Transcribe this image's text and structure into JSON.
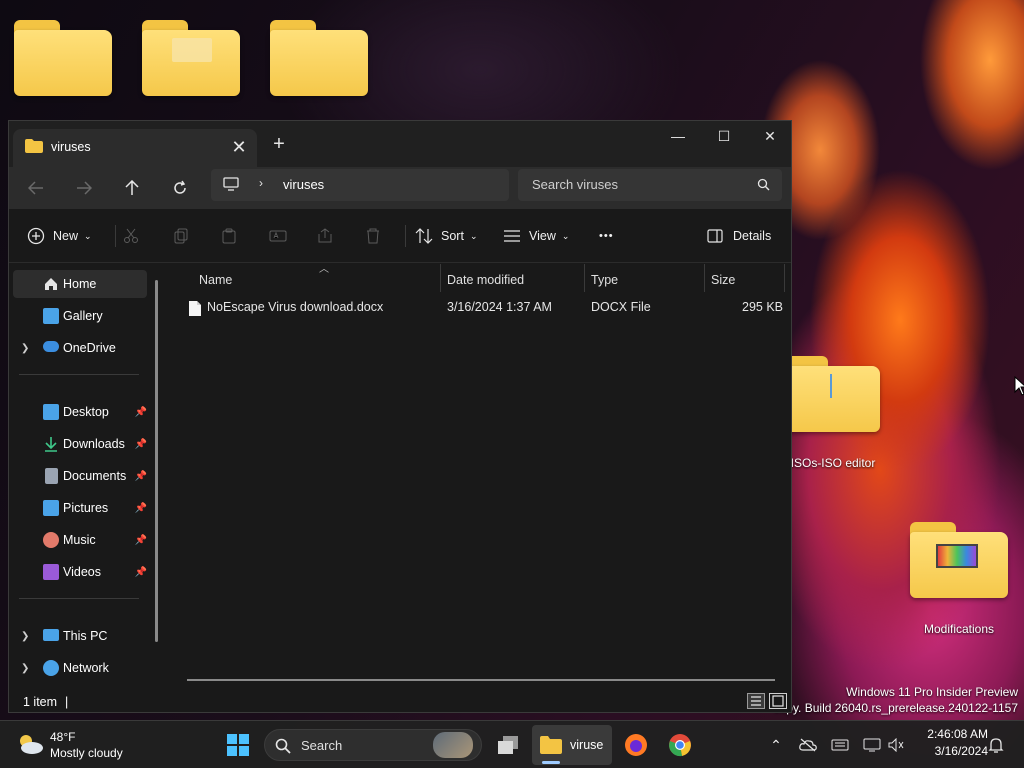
{
  "desktop": {
    "folders": [
      {
        "label": ""
      },
      {
        "label": ""
      },
      {
        "label": ""
      },
      {
        "label": "ISOs-ISO editor"
      },
      {
        "label": "Modifications"
      }
    ],
    "watermark": {
      "line1": "Windows 11 Pro Insider Preview",
      "line2": "copy. Build 26040.rs_prerelease.240122-1157"
    }
  },
  "window": {
    "tab_title": "viruses",
    "tab_close": "✕",
    "new_tab": "+",
    "controls": {
      "minimize": "—",
      "maximize": "☐",
      "close": "✕"
    },
    "address": {
      "segment": "viruses"
    },
    "search": {
      "placeholder": "Search viruses"
    },
    "commands": {
      "new": "New",
      "sort": "Sort",
      "view": "View",
      "more": "•••",
      "details": "Details"
    },
    "sidebar": {
      "items": [
        {
          "label": "Home",
          "icon": "home-icon",
          "color": "#e6e6e6"
        },
        {
          "label": "Gallery",
          "icon": "gallery-icon",
          "color": "#4aa3e8"
        },
        {
          "label": "OneDrive",
          "icon": "cloud-icon",
          "color": "#3b8ee0"
        },
        {
          "label": "Desktop",
          "icon": "desktop-icon",
          "color": "#4aa3e8"
        },
        {
          "label": "Downloads",
          "icon": "download-icon",
          "color": "#3fc88a"
        },
        {
          "label": "Documents",
          "icon": "documents-icon",
          "color": "#9aa4b2"
        },
        {
          "label": "Pictures",
          "icon": "pictures-icon",
          "color": "#4aa3e8"
        },
        {
          "label": "Music",
          "icon": "music-icon",
          "color": "#e27a6a"
        },
        {
          "label": "Videos",
          "icon": "videos-icon",
          "color": "#9a5ad8"
        },
        {
          "label": "This PC",
          "icon": "pc-icon",
          "color": "#4aa3e8"
        },
        {
          "label": "Network",
          "icon": "network-icon",
          "color": "#4aa3e8"
        }
      ]
    },
    "columns": {
      "name": "Name",
      "date": "Date modified",
      "type": "Type",
      "size": "Size"
    },
    "files": [
      {
        "name": "NoEscape Virus download.docx",
        "date": "3/16/2024 1:37 AM",
        "type": "DOCX File",
        "size": "295 KB"
      }
    ],
    "status": "1 item"
  },
  "taskbar": {
    "weather": {
      "temp": "48°F",
      "condition": "Mostly cloudy"
    },
    "search_label": "Search",
    "explorer_label": "viruse",
    "clock": {
      "time": "2:46:08 AM",
      "date": "3/16/2024"
    }
  }
}
